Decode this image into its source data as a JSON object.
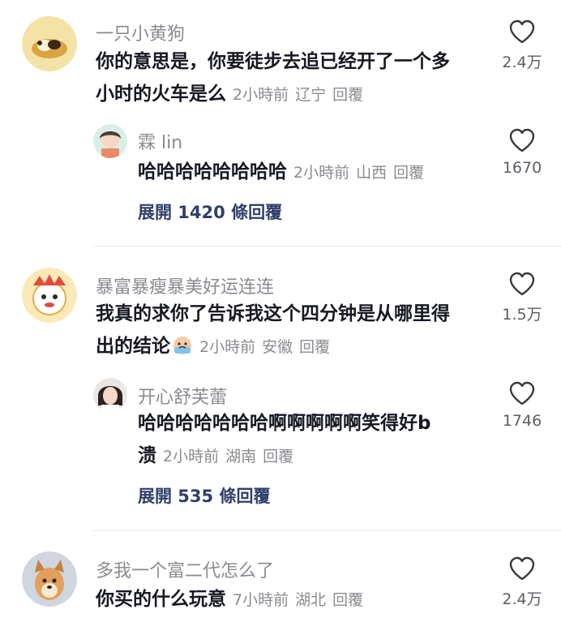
{
  "comments": [
    {
      "username": "一只小黄狗",
      "text_line1": "你的意思是，你要徒步去追已经开了一个多",
      "text_line2": "小时的火车是么",
      "time": "2小時前",
      "location": "辽宁",
      "reply_label": "回覆",
      "likes": "2.4万",
      "icon": "heart-icon",
      "reply": {
        "username": "霖 lin",
        "text_line1": "哈哈哈哈哈哈哈哈",
        "time": "2小時前",
        "location": "山西",
        "reply_label": "回覆",
        "likes": "1670"
      },
      "expand_label": "展開 1420 條回覆"
    },
    {
      "username": "暴富暴瘦暴美好运连连",
      "text_line1": "我真的求你了告诉我这个四分钟是从哪里得",
      "text_line2": "出的结论",
      "emoji": "crying-face-emoji",
      "time": "2小時前",
      "location": "安徽",
      "reply_label": "回覆",
      "likes": "1.5万",
      "reply": {
        "username": "开心舒芙蕾",
        "text_line1": "哈哈哈哈哈哈哈啊啊啊啊啊笑得好b",
        "text_line2": "溃",
        "time": "2小時前",
        "location": "湖南",
        "reply_label": "回覆",
        "likes": "1746"
      },
      "expand_label": "展開 535 條回覆"
    },
    {
      "username": "多我一个富二代怎么了",
      "text_line1": "你买的什么玩意",
      "time": "7小時前",
      "location": "湖北",
      "reply_label": "回覆",
      "likes": "2.4万"
    }
  ],
  "colors": {
    "primary_text": "#161823",
    "secondary_text": "#8a8b91",
    "link_text": "#2f3f6b",
    "divider": "#ececec"
  }
}
